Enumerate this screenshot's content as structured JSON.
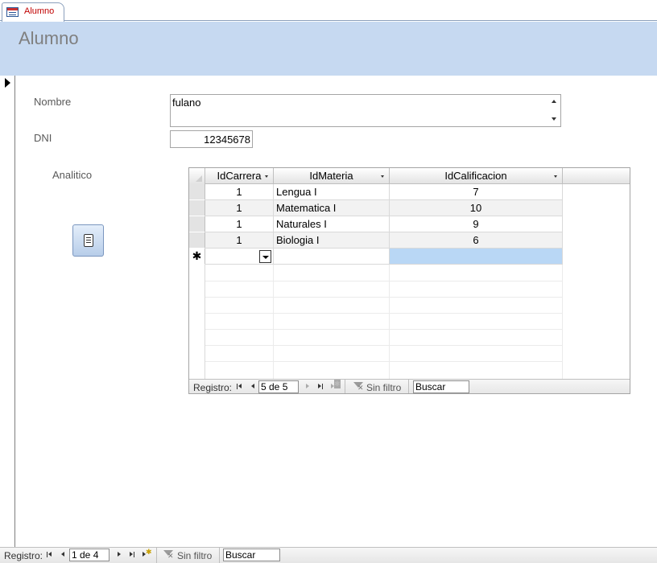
{
  "tab": {
    "label": "Alumno",
    "icon": "form-icon"
  },
  "form": {
    "title": "Alumno",
    "header_color": "#c6d9f1"
  },
  "fields": {
    "nombre_label": "Nombre",
    "nombre_value": "fulano",
    "dni_label": "DNI",
    "dni_value": "12345678",
    "analitico_label": "Analitico"
  },
  "button": {
    "icon": "report-icon"
  },
  "subform": {
    "columns": [
      "IdCarrera",
      "IdMateria",
      "IdCalificacion"
    ],
    "rows": [
      {
        "idcarrera": "1",
        "idmateria": "Lengua I",
        "idcalificacion": "7"
      },
      {
        "idcarrera": "1",
        "idmateria": "Matematica I",
        "idcalificacion": "10"
      },
      {
        "idcarrera": "1",
        "idmateria": "Naturales I",
        "idcalificacion": "9"
      },
      {
        "idcarrera": "1",
        "idmateria": "Biologia I",
        "idcalificacion": "6"
      }
    ],
    "new_row_marker": "✱",
    "nav": {
      "label": "Registro:",
      "position": "5 de 5",
      "filter": "Sin filtro",
      "search": "Buscar"
    },
    "selection_color": "#b9d7f5"
  },
  "main_nav": {
    "label": "Registro:",
    "position": "1 de 4",
    "filter": "Sin filtro",
    "search": "Buscar"
  }
}
